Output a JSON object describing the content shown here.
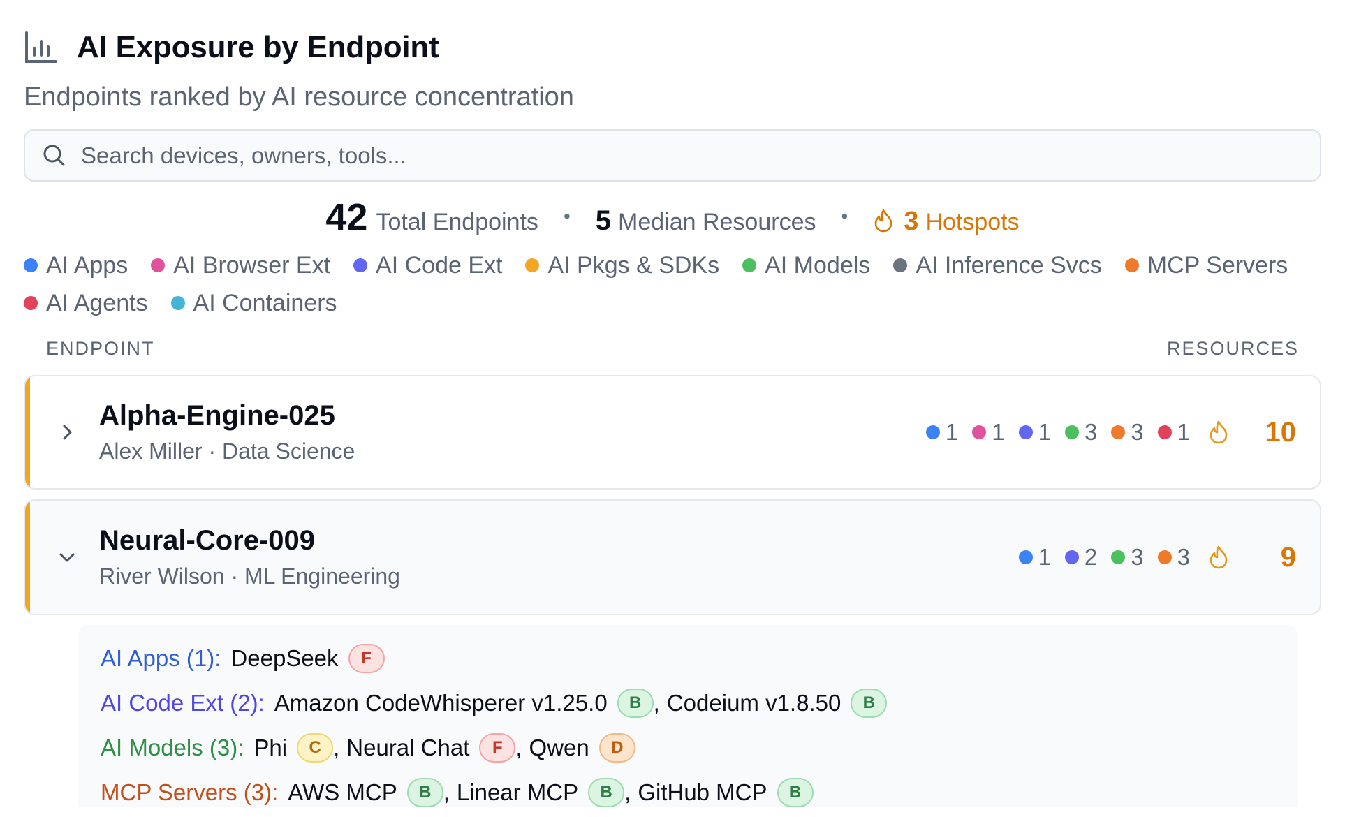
{
  "header": {
    "title": "AI Exposure by Endpoint",
    "subtitle": "Endpoints ranked by AI resource concentration"
  },
  "search": {
    "placeholder": "Search devices, owners, tools..."
  },
  "stats": {
    "total_value": "42",
    "total_label": "Total Endpoints",
    "median_value": "5",
    "median_label": "Median Resources",
    "hotspots_value": "3",
    "hotspots_label": "Hotspots"
  },
  "colors": {
    "apps": "#3b82f6",
    "browser_ext": "#e0529c",
    "code_ext": "#6366f1",
    "pkgs": "#f5a524",
    "models": "#4cbf5e",
    "inference": "#6b7280",
    "mcp": "#f07a2c",
    "agents": "#e2415a",
    "containers": "#44b4d4",
    "hotspot": "#d97706"
  },
  "legend": [
    {
      "label": "AI Apps",
      "color": "#3b82f6"
    },
    {
      "label": "AI Browser Ext",
      "color": "#e0529c"
    },
    {
      "label": "AI Code Ext",
      "color": "#6366f1"
    },
    {
      "label": "AI Pkgs & SDKs",
      "color": "#f5a524"
    },
    {
      "label": "AI Models",
      "color": "#4cbf5e"
    },
    {
      "label": "AI Inference Svcs",
      "color": "#6b7280"
    },
    {
      "label": "MCP Servers",
      "color": "#f07a2c"
    },
    {
      "label": "AI Agents",
      "color": "#e2415a"
    },
    {
      "label": "AI Containers",
      "color": "#44b4d4"
    }
  ],
  "table": {
    "col_endpoint": "ENDPOINT",
    "col_resources": "RESOURCES"
  },
  "rows": [
    {
      "name": "Alpha-Engine-025",
      "owner": "Alex Miller · Data Science",
      "expanded": false,
      "counts": [
        {
          "n": "1",
          "color": "#3b82f6"
        },
        {
          "n": "1",
          "color": "#e0529c"
        },
        {
          "n": "1",
          "color": "#6366f1"
        },
        {
          "n": "3",
          "color": "#4cbf5e"
        },
        {
          "n": "3",
          "color": "#f07a2c"
        },
        {
          "n": "1",
          "color": "#e2415a"
        }
      ],
      "total": "10"
    },
    {
      "name": "Neural-Core-009",
      "owner": "River Wilson · ML Engineering",
      "expanded": true,
      "counts": [
        {
          "n": "1",
          "color": "#3b82f6"
        },
        {
          "n": "2",
          "color": "#6366f1"
        },
        {
          "n": "3",
          "color": "#4cbf5e"
        },
        {
          "n": "3",
          "color": "#f07a2c"
        }
      ],
      "total": "9"
    }
  ],
  "details": [
    {
      "label": "AI Apps (1):",
      "color": "#2f5fd6",
      "tools": [
        {
          "name": "DeepSeek",
          "grade": "F"
        }
      ]
    },
    {
      "label": "AI Code Ext (2):",
      "color": "#4f46e5",
      "tools": [
        {
          "name": "Amazon CodeWhisperer v1.25.0",
          "grade": "B"
        },
        {
          "name": "Codeium v1.8.50",
          "grade": "B"
        }
      ]
    },
    {
      "label": "AI Models (3):",
      "color": "#2f8f46",
      "tools": [
        {
          "name": "Phi",
          "grade": "C"
        },
        {
          "name": "Neural Chat",
          "grade": "F"
        },
        {
          "name": "Qwen",
          "grade": "D"
        }
      ]
    },
    {
      "label": "MCP Servers (3):",
      "color": "#c2501c",
      "tools": [
        {
          "name": "AWS MCP",
          "grade": "B"
        },
        {
          "name": "Linear MCP",
          "grade": "B"
        },
        {
          "name": "GitHub MCP",
          "grade": "B"
        }
      ]
    }
  ]
}
